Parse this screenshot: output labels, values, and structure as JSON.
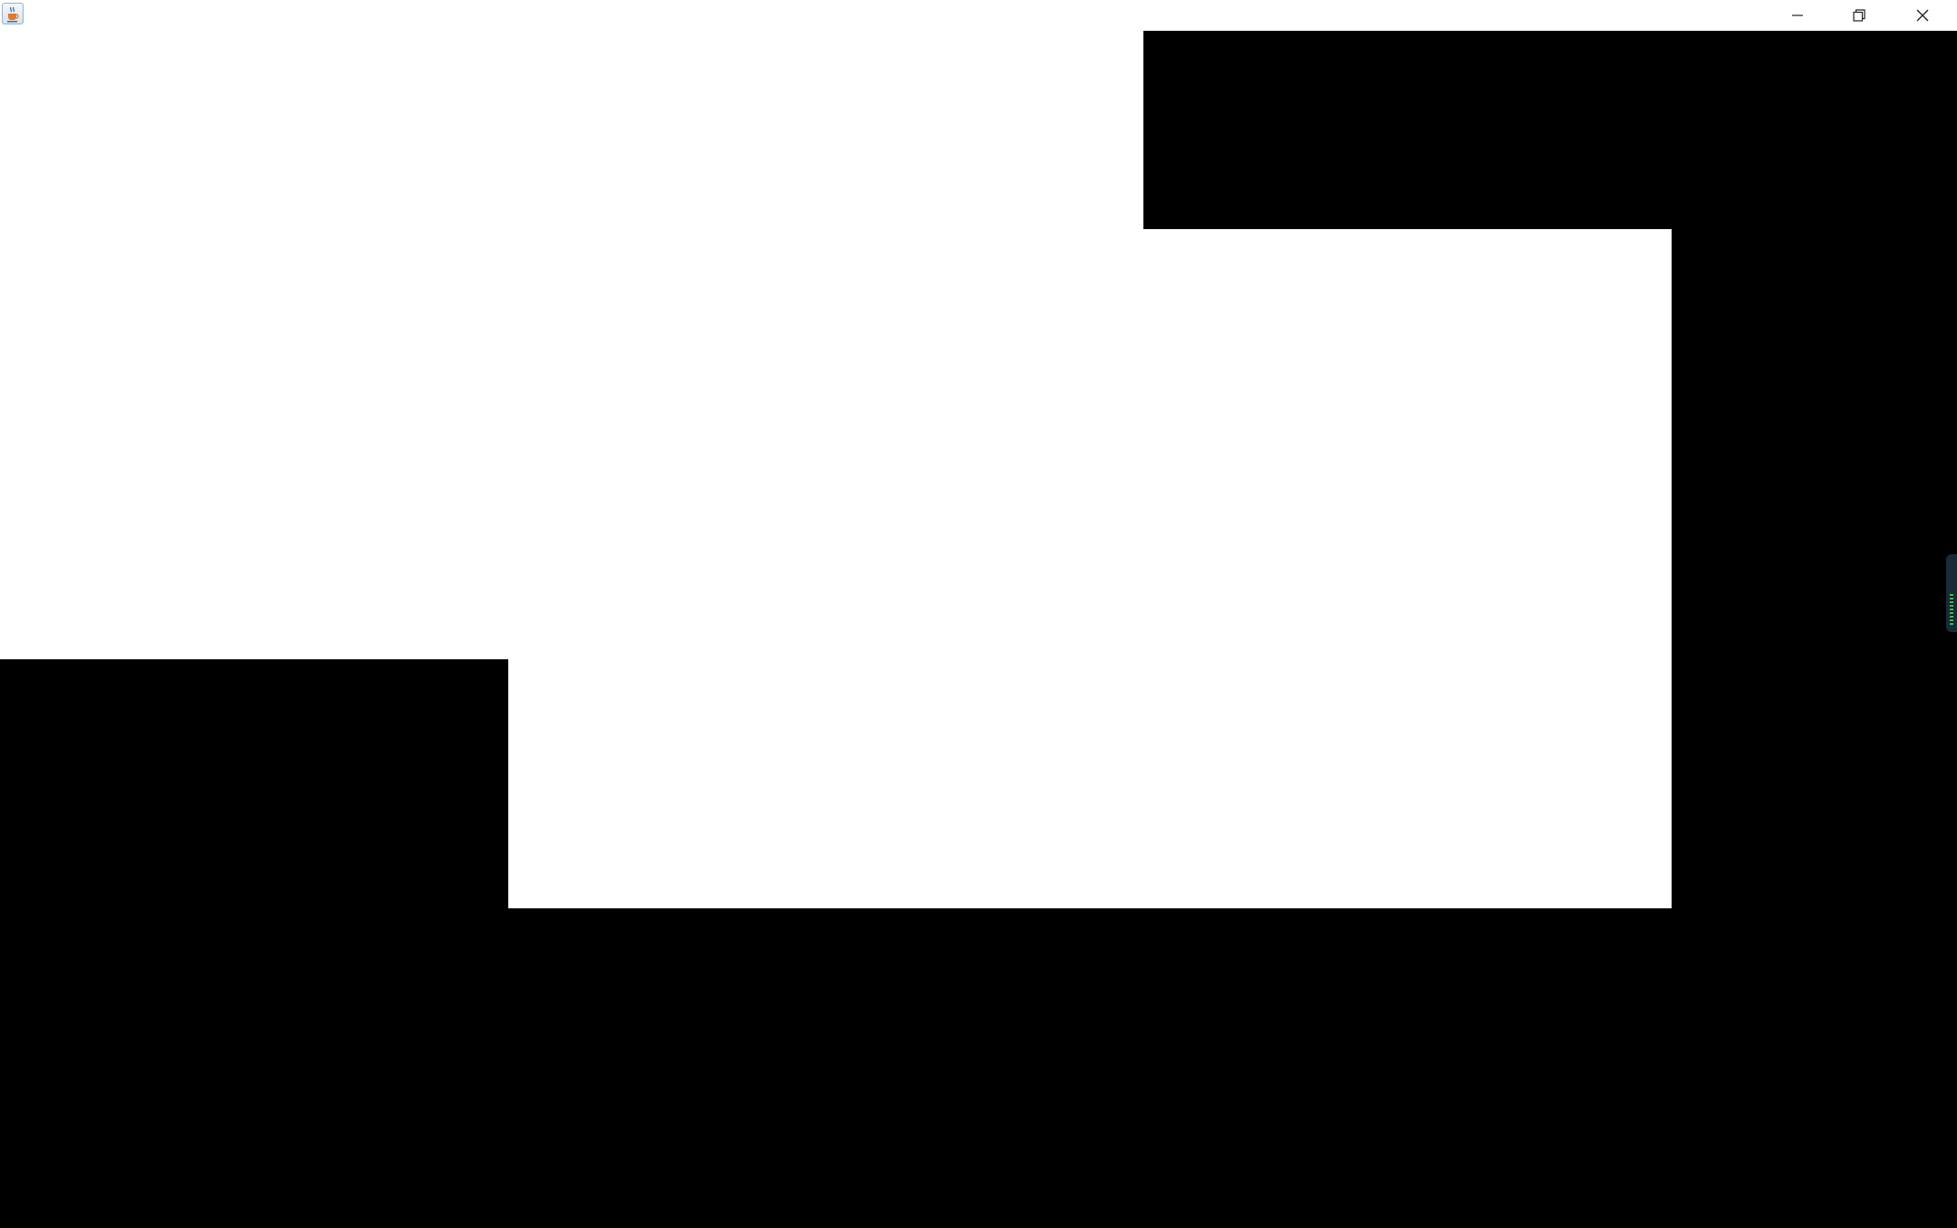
{
  "window": {
    "title": "",
    "app_icon": "java-cup-icon",
    "controls": {
      "minimize_icon": "minimize-icon",
      "restore_icon": "restore-icon",
      "close_icon": "close-icon"
    }
  },
  "canvas": {
    "background_color": "#000000",
    "foreground_color": "#ffffff"
  },
  "side_tab": {
    "icon": "level-meter-icon",
    "accent_color": "#3fb96a"
  }
}
